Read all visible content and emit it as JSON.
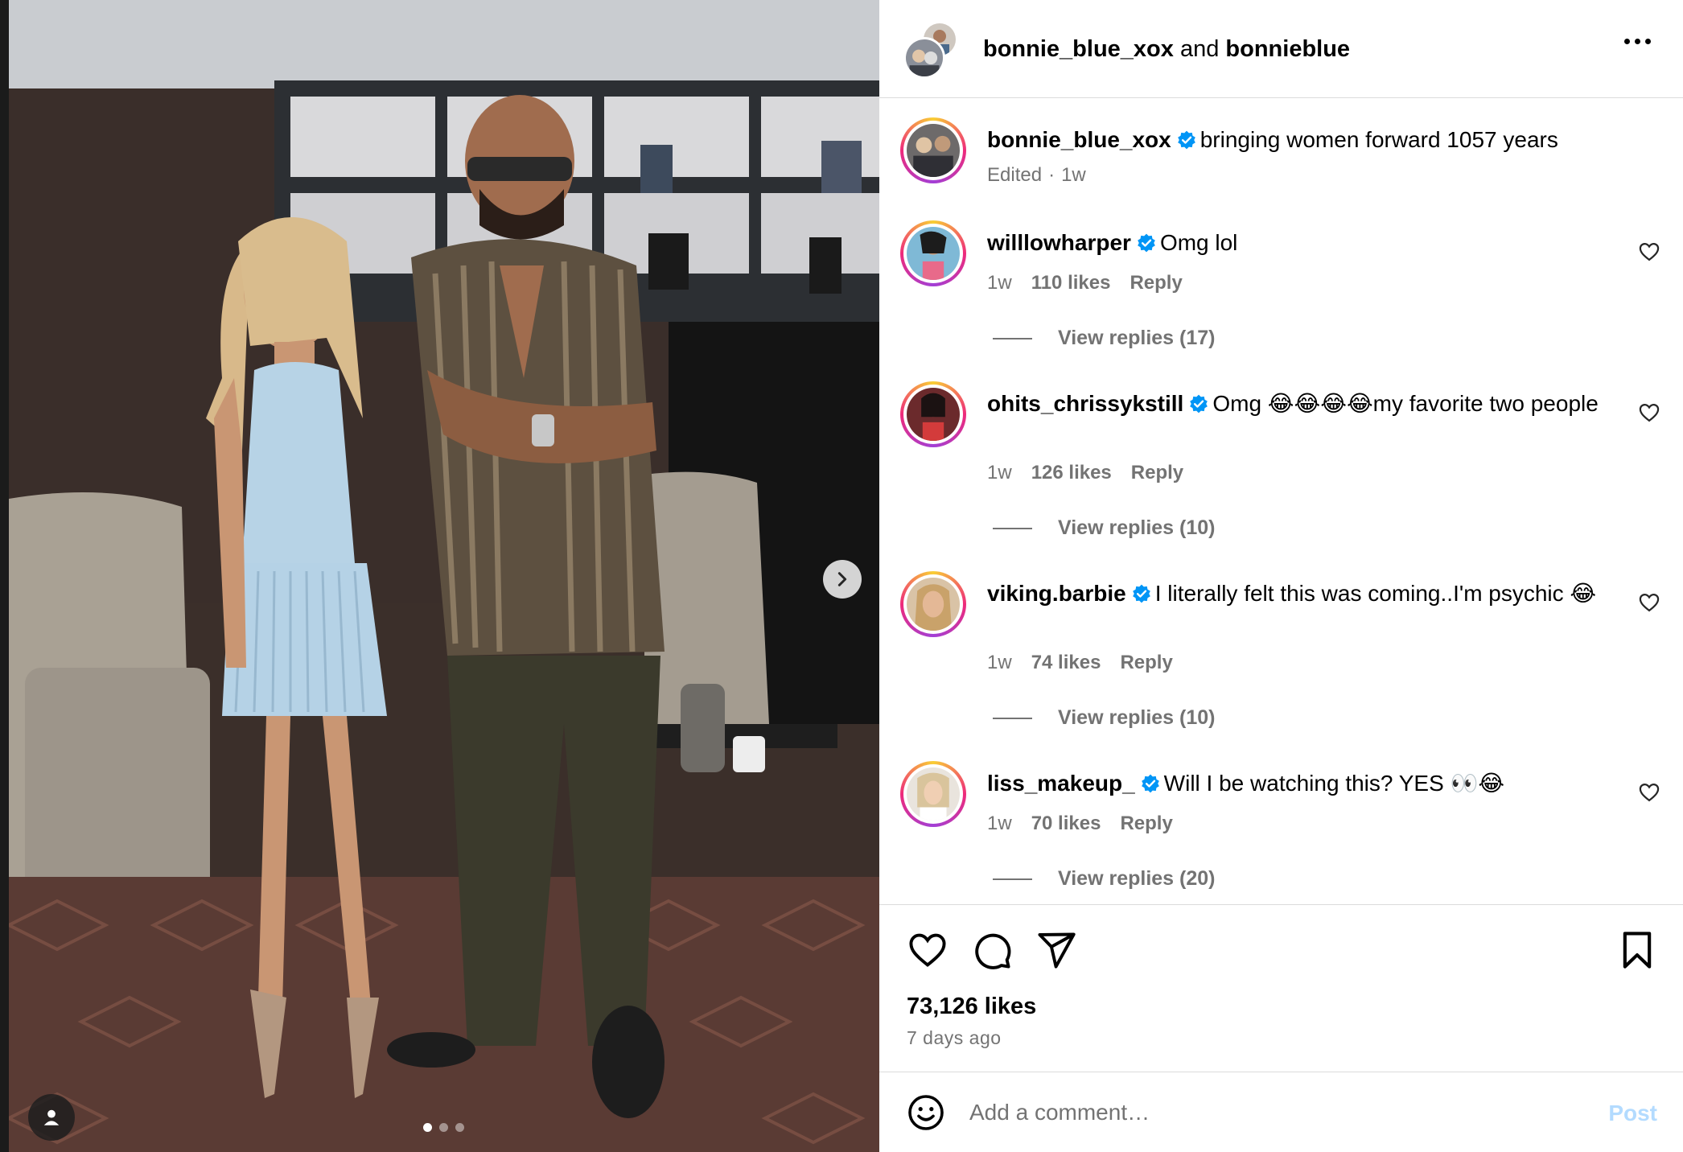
{
  "header": {
    "user1": "bonnie_blue_xox",
    "joiner": "and",
    "user2": "bonnieblue"
  },
  "caption": {
    "username": "bonnie_blue_xox",
    "text": "bringing women forward 1057 years",
    "edited": "Edited",
    "sep": "·",
    "time": "1w"
  },
  "comments": [
    {
      "username": "willlowharper",
      "text": "Omg lol",
      "time": "1w",
      "likes": "110 likes",
      "reply": "Reply",
      "view_replies": "View replies (17)"
    },
    {
      "username": "ohits_chrissykstill",
      "text": "Omg 😂😂😂😂my favorite two people",
      "time": "1w",
      "likes": "126 likes",
      "reply": "Reply",
      "view_replies": "View replies (10)"
    },
    {
      "username": "viking.barbie",
      "text": "I literally felt this was coming..I'm psychic 😂",
      "time": "1w",
      "likes": "74 likes",
      "reply": "Reply",
      "view_replies": "View replies (10)"
    },
    {
      "username": "liss_makeup_",
      "text": "Will I be watching this? YES 👀😂",
      "time": "1w",
      "likes": "70 likes",
      "reply": "Reply",
      "view_replies": "View replies (20)"
    }
  ],
  "stats": {
    "likes": "73,126 likes",
    "ago": "7 days ago"
  },
  "composer": {
    "placeholder": "Add a comment…",
    "post_label": "Post"
  },
  "carousel": {
    "current": 1,
    "total": 3
  },
  "icons": {
    "heart": "heart-icon",
    "comment": "comment-icon",
    "share": "share-icon",
    "save": "bookmark-icon",
    "verified": "verified-badge-icon",
    "emoji": "emoji-icon",
    "next": "chevron-right-icon",
    "tag": "user-tag-icon",
    "more": "more-icon"
  },
  "colors": {
    "verified": "#0095f6",
    "muted": "#737373",
    "post_disabled": "#b3dbff",
    "divider": "#dbdbdb"
  }
}
